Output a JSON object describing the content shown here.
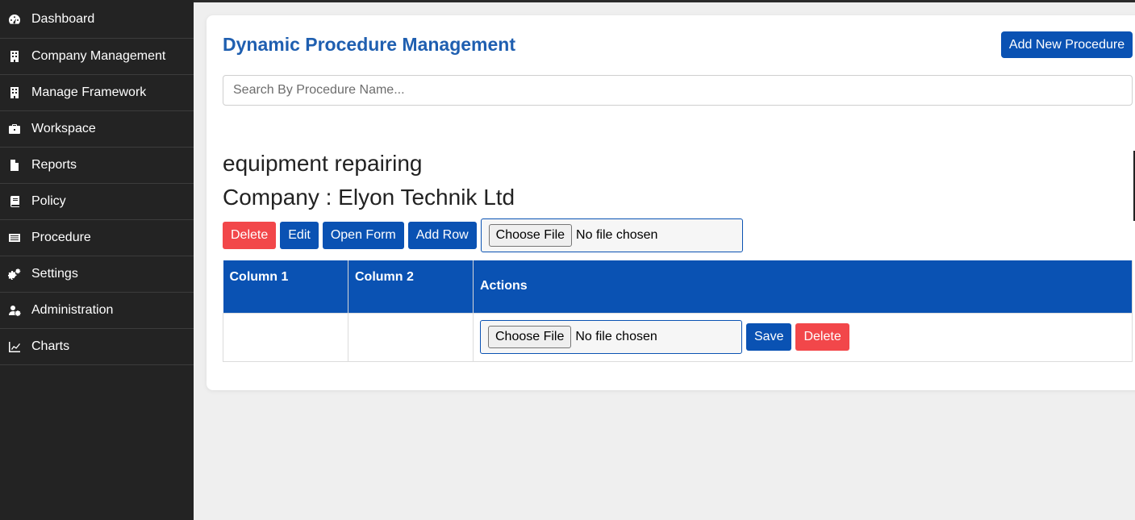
{
  "sidebar": {
    "items": [
      {
        "label": "Dashboard",
        "icon": "dashboard-icon"
      },
      {
        "label": "Company Management",
        "icon": "building-icon"
      },
      {
        "label": "Manage Framework",
        "icon": "building-icon"
      },
      {
        "label": "Workspace",
        "icon": "briefcase-icon"
      },
      {
        "label": "Reports",
        "icon": "file-icon"
      },
      {
        "label": "Policy",
        "icon": "book-icon"
      },
      {
        "label": "Procedure",
        "icon": "list-icon"
      },
      {
        "label": "Settings",
        "icon": "gears-icon"
      },
      {
        "label": "Administration",
        "icon": "user-gear-icon"
      },
      {
        "label": "Charts",
        "icon": "chart-line-icon"
      }
    ]
  },
  "header": {
    "title": "Dynamic Procedure Management",
    "add_button": "Add New Procedure"
  },
  "search": {
    "placeholder": "Search By Procedure Name..."
  },
  "procedure": {
    "name": "equipment repairing",
    "company_line": "Company : Elyon Technik Ltd",
    "buttons": {
      "delete": "Delete",
      "edit": "Edit",
      "open_form": "Open Form",
      "add_row": "Add Row"
    },
    "file": {
      "choose": "Choose File",
      "status": "No file chosen"
    }
  },
  "table": {
    "headers": [
      "Column 1",
      "Column 2",
      "Actions"
    ],
    "row": {
      "col1": "",
      "col2": "",
      "file_choose": "Choose File",
      "file_status": "No file chosen",
      "save": "Save",
      "delete": "Delete"
    }
  },
  "colors": {
    "sidebar_bg": "#232323",
    "primary": "#0a52b3",
    "danger": "#f2474a",
    "title": "#1f5fb0"
  }
}
